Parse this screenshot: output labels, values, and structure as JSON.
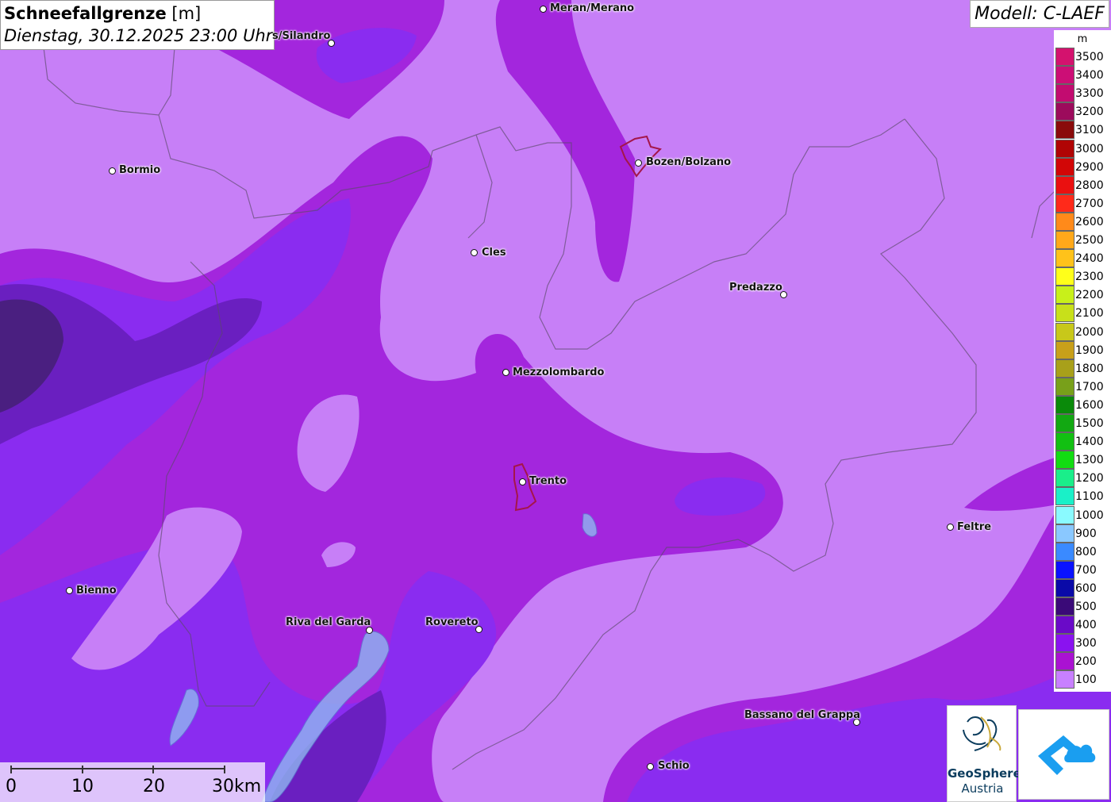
{
  "header": {
    "title_bold": "Schneefallgrenze",
    "title_unit": "[m]",
    "datetime": "Dienstag, 30.12.2025 23:00 Uhr"
  },
  "model": {
    "label": "Modell: C-LAEF"
  },
  "legend": {
    "unit": "m",
    "levels": [
      {
        "value": "3500",
        "color": "#d4126e"
      },
      {
        "value": "3400",
        "color": "#cc0e76"
      },
      {
        "value": "3300",
        "color": "#c20c70"
      },
      {
        "value": "3200",
        "color": "#9c0b5c"
      },
      {
        "value": "3100",
        "color": "#8a0b0b"
      },
      {
        "value": "3000",
        "color": "#b00404"
      },
      {
        "value": "2900",
        "color": "#d20606"
      },
      {
        "value": "2800",
        "color": "#ea1010"
      },
      {
        "value": "2700",
        "color": "#ff2a1a"
      },
      {
        "value": "2600",
        "color": "#ff8a1a"
      },
      {
        "value": "2500",
        "color": "#ffa81a"
      },
      {
        "value": "2400",
        "color": "#ffc21a"
      },
      {
        "value": "2300",
        "color": "#ffff1a"
      },
      {
        "value": "2200",
        "color": "#c8f01a"
      },
      {
        "value": "2100",
        "color": "#c8e01a"
      },
      {
        "value": "2000",
        "color": "#c8c81a"
      },
      {
        "value": "1900",
        "color": "#c8a01a"
      },
      {
        "value": "1800",
        "color": "#a8a01a"
      },
      {
        "value": "1700",
        "color": "#78a01a"
      },
      {
        "value": "1600",
        "color": "#0a8a0a"
      },
      {
        "value": "1500",
        "color": "#12a812"
      },
      {
        "value": "1400",
        "color": "#12c012"
      },
      {
        "value": "1300",
        "color": "#12dc12"
      },
      {
        "value": "1200",
        "color": "#1aee8a"
      },
      {
        "value": "1100",
        "color": "#1af0c8"
      },
      {
        "value": "1000",
        "color": "#8afaff"
      },
      {
        "value": "900",
        "color": "#8ac8ff"
      },
      {
        "value": "800",
        "color": "#3a8aff"
      },
      {
        "value": "700",
        "color": "#0a12ff"
      },
      {
        "value": "600",
        "color": "#0a0aa8"
      },
      {
        "value": "500",
        "color": "#3a0a78"
      },
      {
        "value": "400",
        "color": "#6a0ac8"
      },
      {
        "value": "300",
        "color": "#8a12f0"
      },
      {
        "value": "200",
        "color": "#aa12d2"
      },
      {
        "value": "100",
        "color": "#c880ff"
      }
    ]
  },
  "cities": [
    {
      "name": "Meran/Merano"
    },
    {
      "name": "s/Silandro"
    },
    {
      "name": "Bormio"
    },
    {
      "name": "Bozen/Bolzano"
    },
    {
      "name": "Cles"
    },
    {
      "name": "Predazzo"
    },
    {
      "name": "Mezzolombardo"
    },
    {
      "name": "Trento"
    },
    {
      "name": "Feltre"
    },
    {
      "name": "Bienno"
    },
    {
      "name": "Riva del Garda"
    },
    {
      "name": "Rovereto"
    },
    {
      "name": "Bassano del Grappa"
    },
    {
      "name": "Schio"
    }
  ],
  "scale": {
    "ticks": [
      "0",
      "10",
      "20",
      "30km"
    ]
  },
  "logos": {
    "geo_line1": "GeoSphere",
    "geo_line2": "Austria"
  },
  "colors": {
    "snowline_100": "#c77ff7",
    "snowline_200": "#a326dd",
    "snowline_300": "#8a2cf0",
    "snowline_400": "#6a1fc0",
    "snowline_500": "#4a1f80"
  }
}
